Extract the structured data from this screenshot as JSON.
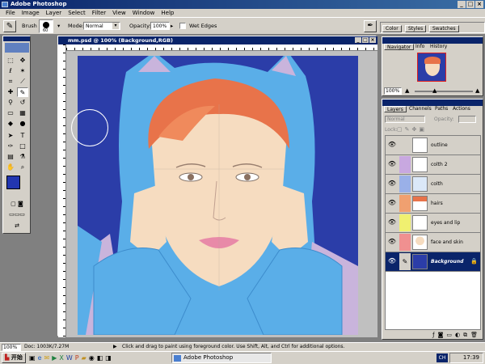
{
  "window": {
    "title": "Adobe Photoshop"
  },
  "menu": [
    "File",
    "Image",
    "Layer",
    "Select",
    "Filter",
    "View",
    "Window",
    "Help"
  ],
  "options_bar": {
    "brush_label": "Brush",
    "brush_size": "60",
    "mode_label": "Mode:",
    "mode_value": "Normal",
    "opacity_label": "Opacity:",
    "opacity_value": "100%",
    "wet_edges_label": "Wet Edges"
  },
  "palette_well": [
    "Color",
    "Styles",
    "Swatches"
  ],
  "document": {
    "title": "mm.psd @ 100% (Background,RGB)"
  },
  "navigator": {
    "tabs": [
      "Navigator",
      "Info",
      "History"
    ],
    "zoom": "100%"
  },
  "layers_panel": {
    "tabs": [
      "Layers",
      "Channels",
      "Paths",
      "Actions"
    ],
    "blend_mode": "Normal",
    "opacity_label": "Opacity:",
    "lock_label": "Lock:",
    "layers": [
      {
        "name": "outline",
        "color": "#d4d0c8"
      },
      {
        "name": "colth 2",
        "color": "#c8a8e0"
      },
      {
        "name": "colth",
        "color": "#9ab0e8"
      },
      {
        "name": "hairs",
        "color": "#f0a070"
      },
      {
        "name": "eyes and lip",
        "color": "#f0f070"
      },
      {
        "name": "face and skin",
        "color": "#f09090"
      },
      {
        "name": "Background",
        "color": "#d4d0c8",
        "selected": true
      }
    ]
  },
  "status_bar": {
    "zoom": "100%",
    "doc_info": "Doc: 1003K/7.27M",
    "hint": "Click and drag to paint using foreground color.  Use Shift, Alt, and Ctrl for additional options."
  },
  "taskbar": {
    "start_label": "开始",
    "app_button": "Adobe Photoshop",
    "ime_label": "CH",
    "clock": "17:39"
  },
  "colors": {
    "titlebar": "#0a246a",
    "canvas_bg": "#2b3da8",
    "hair": "#e8734a",
    "hood": "#5aaee8",
    "skin": "#f6dcc0"
  }
}
